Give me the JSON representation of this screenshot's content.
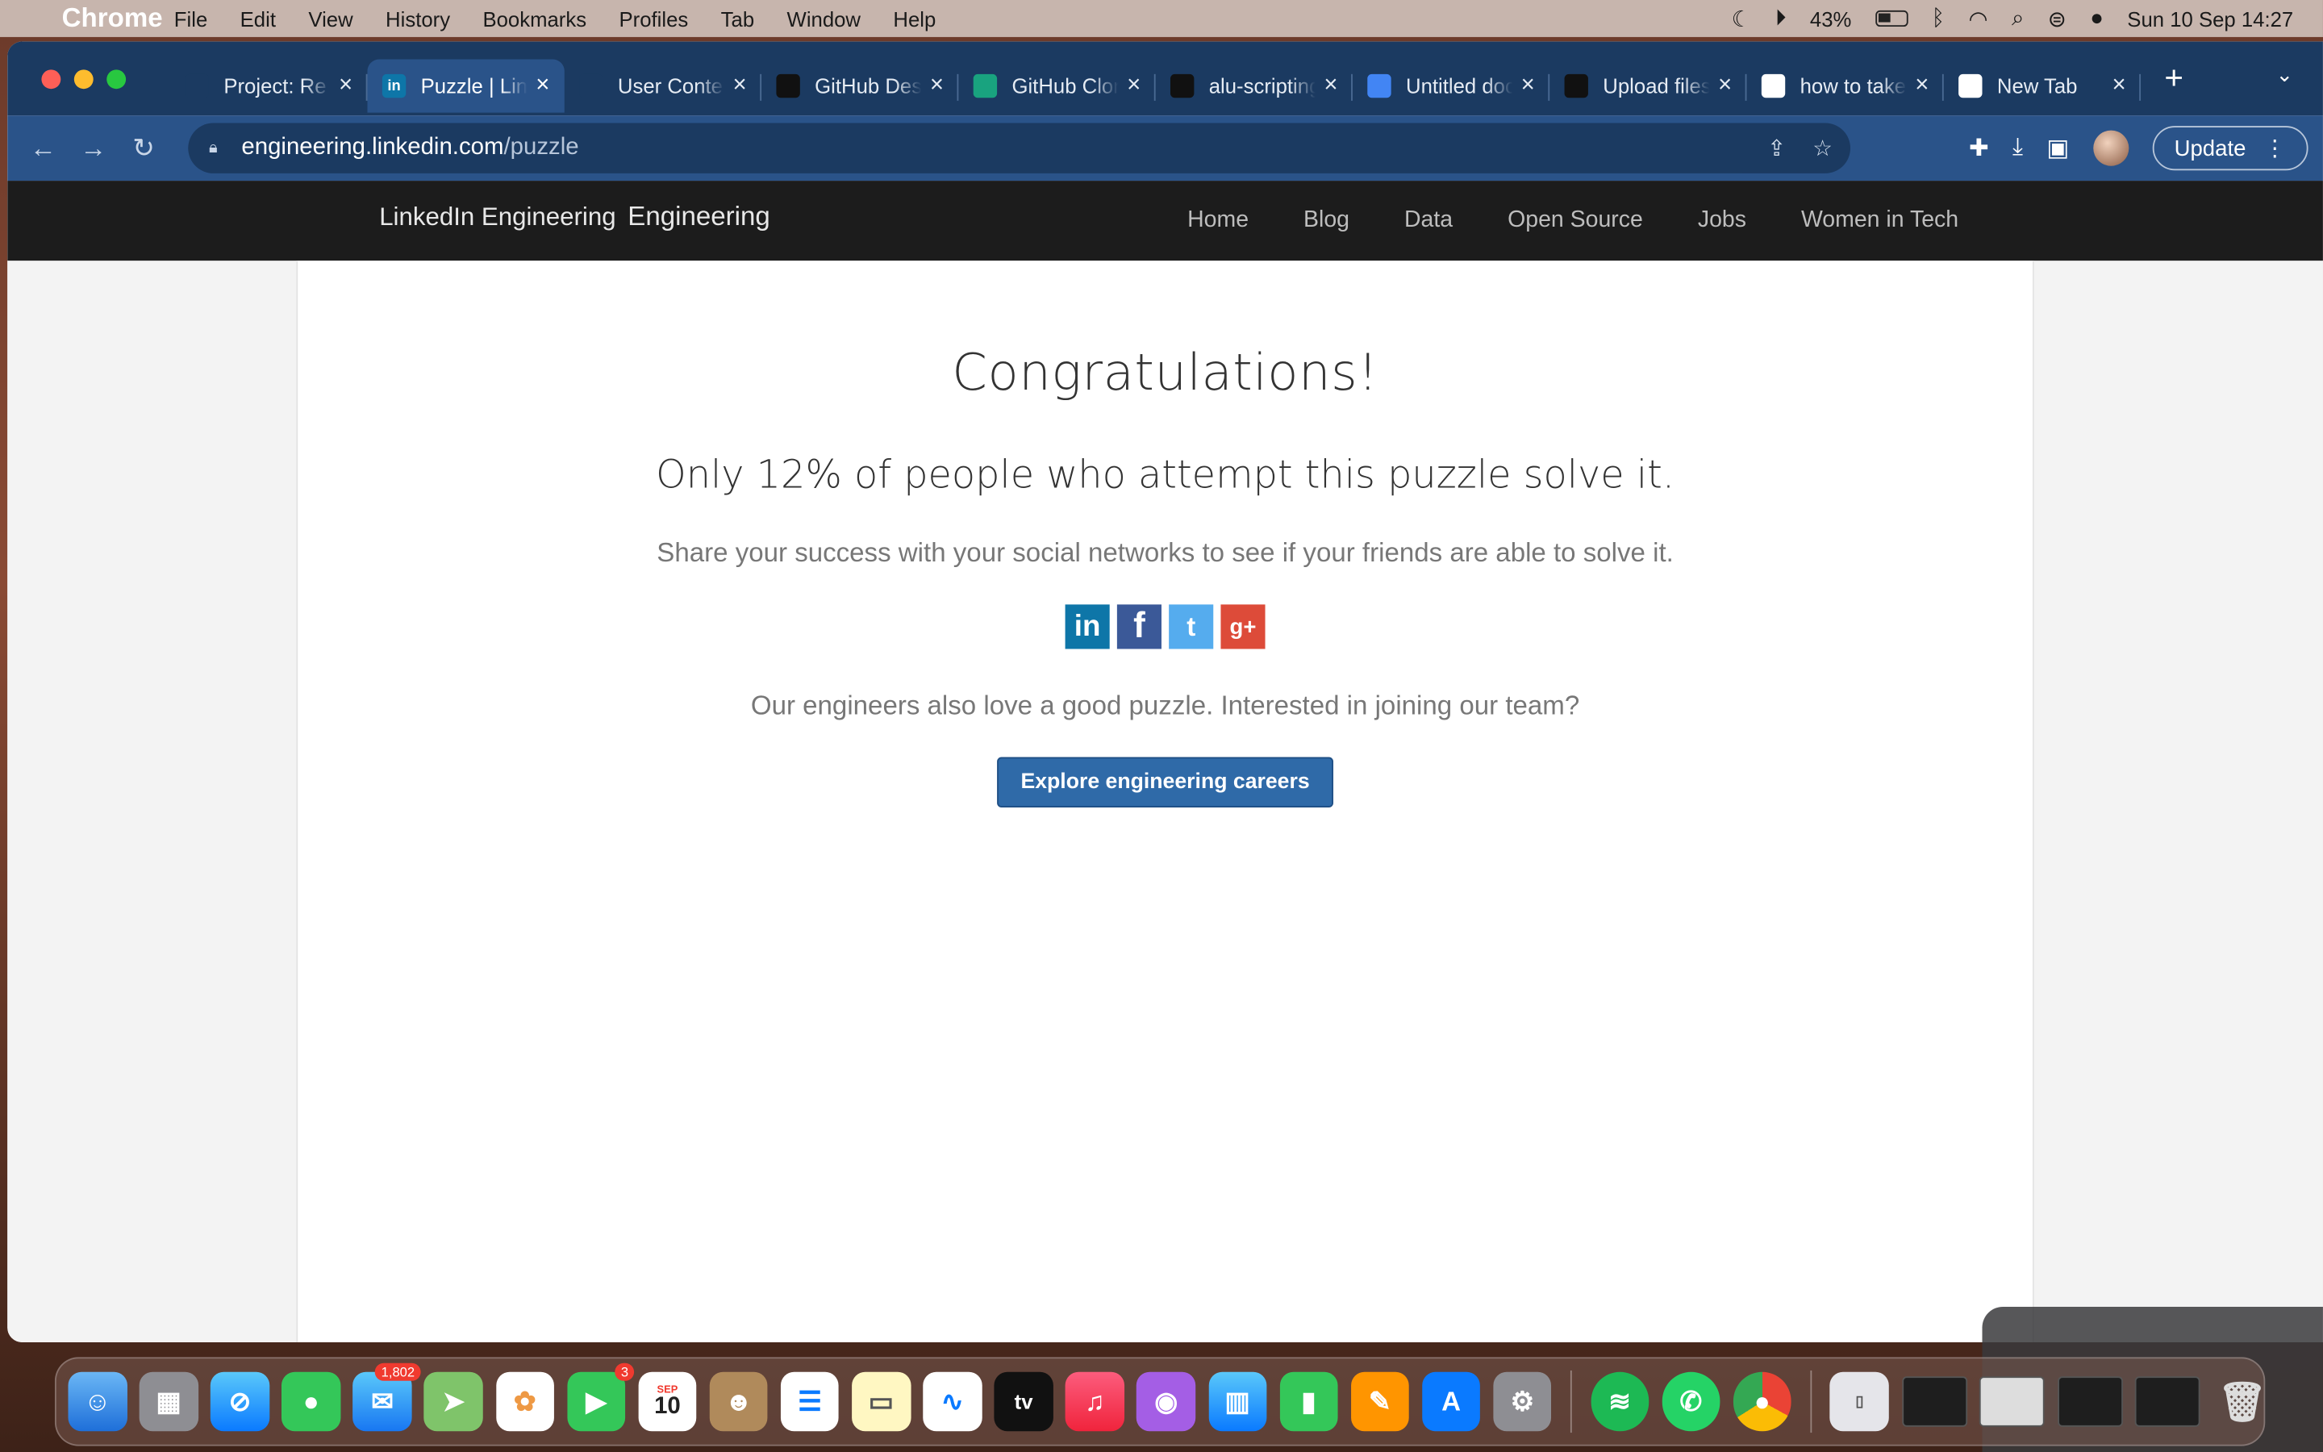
{
  "menubar": {
    "app": "Chrome",
    "items": [
      "File",
      "Edit",
      "View",
      "History",
      "Bookmarks",
      "Profiles",
      "Tab",
      "Window",
      "Help"
    ],
    "battery": "43%",
    "datetime": "Sun 10 Sep  14:27"
  },
  "tabs": [
    {
      "title": "Project: Re",
      "favicon": "alu-icon",
      "color": "#1b3a61"
    },
    {
      "title": "Puzzle | LinkedIn",
      "favicon": "linkedin-icon",
      "color": "#0e76a8",
      "active": true
    },
    {
      "title": "User Content",
      "favicon": "alu-icon",
      "color": "#1b3a61"
    },
    {
      "title": "GitHub Desktop",
      "favicon": "github-icon",
      "color": "#111"
    },
    {
      "title": "GitHub Clone",
      "favicon": "openai-icon",
      "color": "#19a37f"
    },
    {
      "title": "alu-scripting",
      "favicon": "github-icon",
      "color": "#111"
    },
    {
      "title": "Untitled document",
      "favicon": "docs-icon",
      "color": "#4285f4"
    },
    {
      "title": "Upload files",
      "favicon": "github-icon",
      "color": "#111"
    },
    {
      "title": "how to take",
      "favicon": "google-icon",
      "color": "#fff"
    },
    {
      "title": "New Tab",
      "favicon": "chrome-icon",
      "color": "#fff"
    }
  ],
  "address": {
    "host": "engineering.linkedin.com",
    "path": "/puzzle"
  },
  "toolbar": {
    "update_label": "Update"
  },
  "site": {
    "logo_alt": "LinkedIn Engineering",
    "brand": "Engineering",
    "nav": [
      "Home",
      "Blog",
      "Data",
      "Open Source",
      "Jobs",
      "Women in Tech"
    ]
  },
  "main": {
    "heading": "Congratulations!",
    "subheading": "Only 12% of people who attempt this puzzle solve it.",
    "share_text": "Share your success with your social networks to see if your friends are able to solve it.",
    "join_text": "Our engineers also love a good puzzle. Interested in joining our team?",
    "cta_label": "Explore engineering careers"
  },
  "social": [
    "in",
    "f",
    "t",
    "g+"
  ],
  "dock": {
    "mail_badge": "1,802",
    "facetime_badge": "3",
    "calendar_month": "SEP",
    "calendar_day": "10",
    "tv_label": "tv"
  }
}
